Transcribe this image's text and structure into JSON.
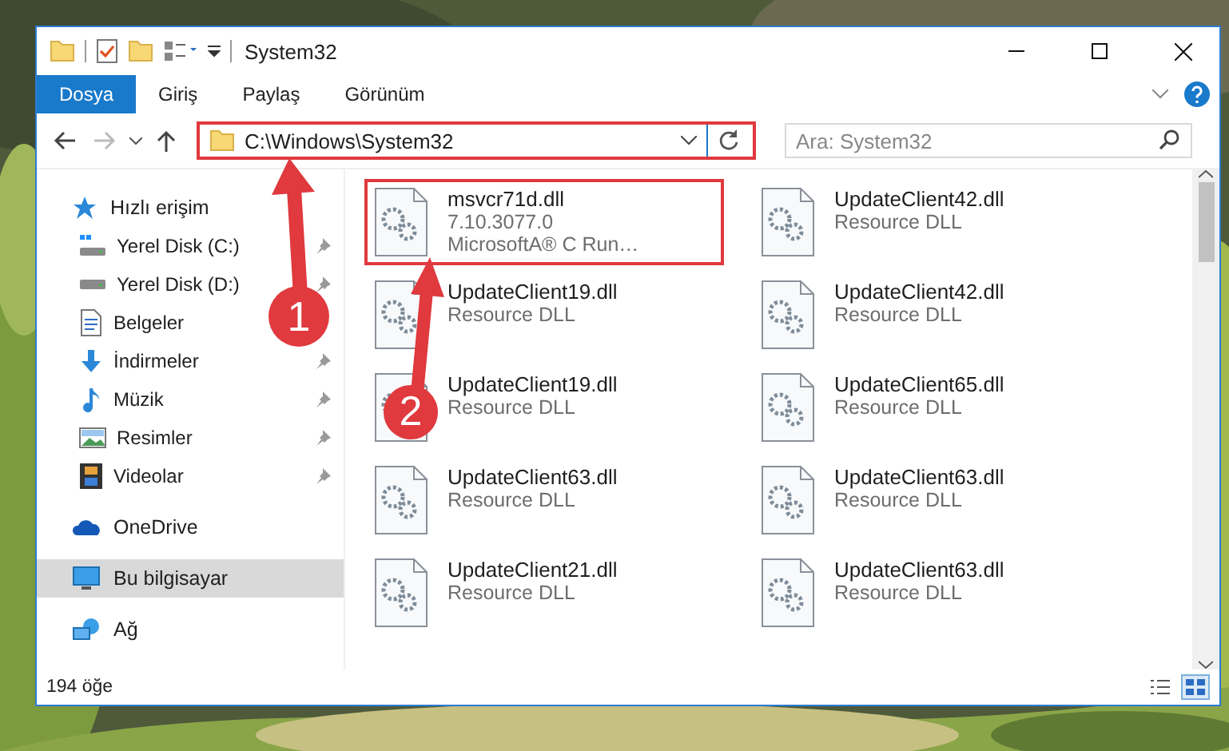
{
  "window": {
    "title": "System32"
  },
  "ribbon": {
    "tabs": [
      {
        "label": "Dosya",
        "selected": true
      },
      {
        "label": "Giriş",
        "selected": false
      },
      {
        "label": "Paylaş",
        "selected": false
      },
      {
        "label": "Görünüm",
        "selected": false
      }
    ]
  },
  "navigation": {
    "back": {
      "disabled": false
    },
    "forward": {
      "disabled": true
    }
  },
  "address": {
    "path": "C:\\Windows\\System32",
    "highlighted": true
  },
  "search": {
    "placeholder": "Ara: System32"
  },
  "sidebar": {
    "items": [
      {
        "label": "Hızlı erişim",
        "kind": "star",
        "selected": false,
        "pinned": false,
        "children": [
          {
            "label": "Yerel Disk (C:)",
            "kind": "windows-drive",
            "selected": false,
            "pinned": true
          },
          {
            "label": "Yerel Disk (D:)",
            "kind": "drive",
            "selected": false,
            "pinned": true
          },
          {
            "label": "Belgeler",
            "kind": "document",
            "selected": false,
            "pinned": false
          },
          {
            "label": "İndirmeler",
            "kind": "download",
            "selected": false,
            "pinned": true
          },
          {
            "label": "Müzik",
            "kind": "music",
            "selected": false,
            "pinned": true
          },
          {
            "label": "Resimler",
            "kind": "pictures",
            "selected": false,
            "pinned": true
          },
          {
            "label": "Videolar",
            "kind": "video",
            "selected": false,
            "pinned": true
          }
        ]
      },
      {
        "label": "OneDrive",
        "kind": "cloud",
        "selected": false,
        "pinned": false
      },
      {
        "label": "Bu bilgisayar",
        "kind": "computer",
        "selected": true,
        "pinned": false
      },
      {
        "label": "Ağ",
        "kind": "network",
        "selected": false,
        "pinned": false
      }
    ]
  },
  "files": [
    {
      "name": "msvcr71d.dll",
      "details": [
        "7.10.3077.0",
        "MicrosoftA® C Run…"
      ],
      "highlighted": true
    },
    {
      "name": "UpdateClient42.dll",
      "details": [
        "Resource DLL"
      ],
      "highlighted": false
    },
    {
      "name": "UpdateClient19.dll",
      "details": [
        "Resource DLL"
      ],
      "highlighted": false
    },
    {
      "name": "UpdateClient42.dll",
      "details": [
        "Resource DLL"
      ],
      "highlighted": false
    },
    {
      "name": "UpdateClient19.dll",
      "details": [
        "Resource DLL"
      ],
      "highlighted": false
    },
    {
      "name": "UpdateClient65.dll",
      "details": [
        "Resource DLL"
      ],
      "highlighted": false
    },
    {
      "name": "UpdateClient63.dll",
      "details": [
        "Resource DLL"
      ],
      "highlighted": false
    },
    {
      "name": "UpdateClient63.dll",
      "details": [
        "Resource DLL"
      ],
      "highlighted": false
    },
    {
      "name": "UpdateClient21.dll",
      "details": [
        "Resource DLL"
      ],
      "highlighted": false
    },
    {
      "name": "UpdateClient63.dll",
      "details": [
        "Resource DLL"
      ],
      "highlighted": false
    }
  ],
  "status_bar": {
    "count": "194 öğe",
    "views": [
      {
        "kind": "details",
        "selected": false
      },
      {
        "kind": "tiles",
        "selected": true
      }
    ]
  },
  "annotations": [
    {
      "label": "1"
    },
    {
      "label": "2"
    }
  ]
}
